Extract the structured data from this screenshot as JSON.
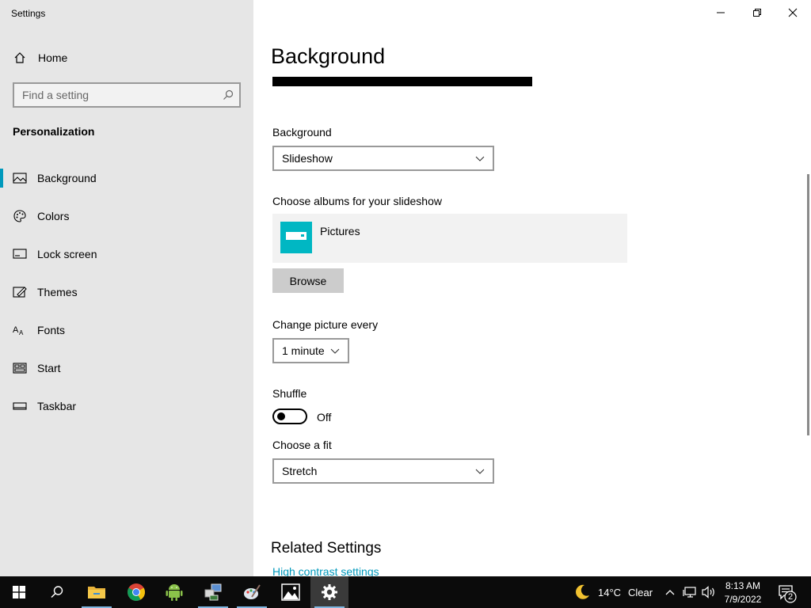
{
  "window": {
    "title": "Settings"
  },
  "sidebar": {
    "home_label": "Home",
    "search_placeholder": "Find a setting",
    "section_title": "Personalization",
    "items": [
      {
        "label": "Background",
        "icon": "picture-icon",
        "active": true
      },
      {
        "label": "Colors",
        "icon": "palette-icon",
        "active": false
      },
      {
        "label": "Lock screen",
        "icon": "lock-screen-icon",
        "active": false
      },
      {
        "label": "Themes",
        "icon": "themes-icon",
        "active": false
      },
      {
        "label": "Fonts",
        "icon": "fonts-icon",
        "active": false
      },
      {
        "label": "Start",
        "icon": "start-icon",
        "active": false
      },
      {
        "label": "Taskbar",
        "icon": "taskbar-icon",
        "active": false
      }
    ]
  },
  "main": {
    "page_title": "Background",
    "background_label": "Background",
    "background_value": "Slideshow",
    "albums_label": "Choose albums for your slideshow",
    "album_name": "Pictures",
    "browse_label": "Browse",
    "interval_label": "Change picture every",
    "interval_value": "1 minute",
    "shuffle_label": "Shuffle",
    "shuffle_state": "Off",
    "shuffle_on": false,
    "fit_label": "Choose a fit",
    "fit_value": "Stretch",
    "related_title": "Related Settings",
    "high_contrast_link": "High contrast settings"
  },
  "taskbar": {
    "apps": [
      "start-icon",
      "search-icon",
      "file-explorer-icon",
      "chrome-icon",
      "android-icon",
      "network-tool-icon",
      "paint-icon",
      "photos-icon",
      "settings-icon"
    ],
    "weather_temp": "14°C",
    "weather_condition": "Clear",
    "time": "8:13 AM",
    "date": "7/9/2022",
    "notification_count": "2"
  },
  "colors": {
    "accent": "#0099bc",
    "sidebar_bg": "#e6e6e6",
    "album_thumb": "#00b7c3",
    "taskbar_bg": "#0b0b0b"
  }
}
